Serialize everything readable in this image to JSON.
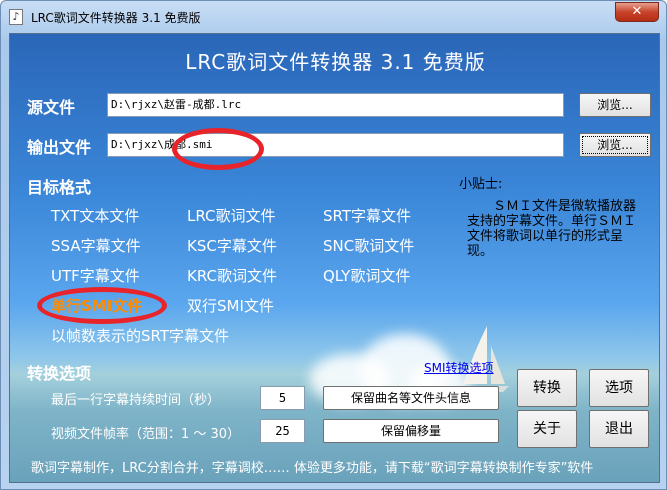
{
  "window": {
    "title": "LRC歌词文件转换器 3.1 免费版",
    "close": "✕"
  },
  "header": "LRC歌词文件转换器 3.1 免费版",
  "source": {
    "label": "源文件",
    "value": "D:\\rjxz\\赵雷-成都.lrc",
    "browse": "浏览..."
  },
  "output": {
    "label": "输出文件",
    "value": "D:\\rjxz\\成都.smi",
    "browse": "浏览..."
  },
  "target": {
    "label": "目标格式",
    "formats": [
      "TXT文本文件",
      "LRC歌词文件",
      "SRT字幕文件",
      "SSA字幕文件",
      "KSC字幕文件",
      "SNC歌词文件",
      "UTF字幕文件",
      "KRC歌词文件",
      "QLY歌词文件",
      "单行SMI文件",
      "双行SMI文件",
      "以帧数表示的SRT字幕文件"
    ],
    "selected": "单行SMI文件"
  },
  "tips": {
    "label": "小贴士:",
    "text": "　　ＳＭＩ文件是微软播放器支持的字幕文件。单行ＳＭＩ文件将歌词以单行的形式呈现。"
  },
  "options": {
    "label": "转换选项",
    "smi_link": "SMI转换选项",
    "last_line_label": "最后一行字幕持续时间（秒）",
    "last_line_value": "5",
    "fps_label": "视频文件帧率（范围：1 ～ 30）",
    "fps_value": "25",
    "keep_header": "保留曲名等文件头信息",
    "keep_offset": "保留偏移量"
  },
  "buttons": {
    "convert": "转换",
    "options": "选项",
    "about": "关于",
    "exit": "退出"
  },
  "footer": "歌词字幕制作，LRC分割合并，字幕调校…… 体验更多功能，请下载“歌词字幕转换制作专家”软件",
  "colors": {
    "selected": "#ff8c00",
    "link": "#0000ee",
    "annotation": "#e8242a"
  }
}
